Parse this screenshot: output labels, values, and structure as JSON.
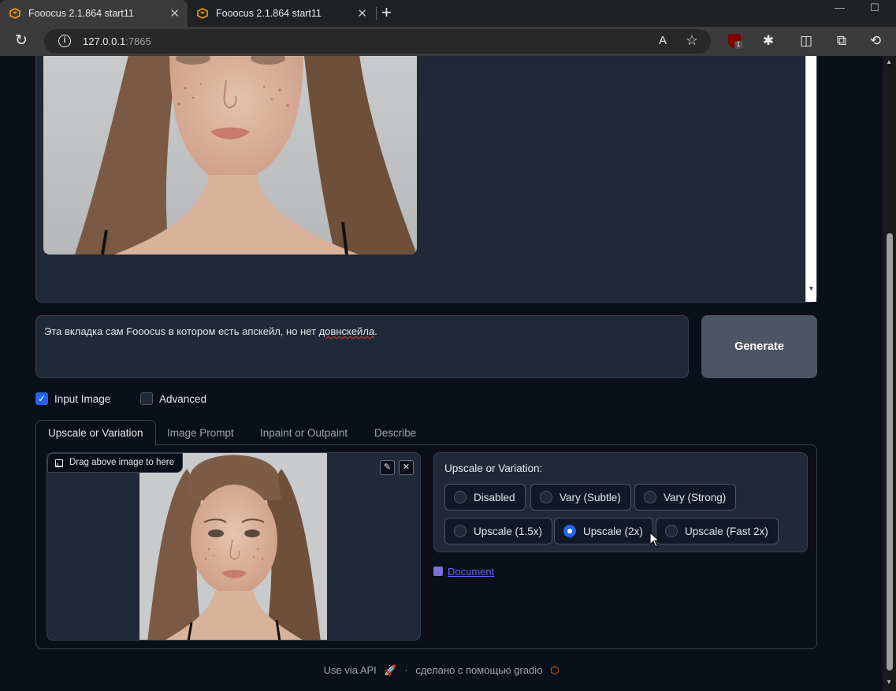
{
  "browser": {
    "tabs": [
      {
        "title": "Fooocus 2.1.864 start11",
        "active": true
      },
      {
        "title": "Fooocus 2.1.864 start11",
        "active": false
      }
    ],
    "new_tab": "+",
    "url_host": "127.0.0.1",
    "url_port": ":7865",
    "extension_badge": "1"
  },
  "prompt": {
    "text_before": "Эта вкладка сам Fooocus в котором есть апскейл, но нет ",
    "misspelled": "довнскейла",
    "text_after": "."
  },
  "generate_label": "Generate",
  "options": {
    "input_image": {
      "label": "Input Image",
      "checked": true
    },
    "advanced": {
      "label": "Advanced",
      "checked": false
    }
  },
  "tabs": [
    "Upscale or Variation",
    "Image Prompt",
    "Inpaint or Outpaint",
    "Describe"
  ],
  "selected_tab": "Upscale or Variation",
  "input_image": {
    "label": "Drag above image to here"
  },
  "upscale": {
    "header": "Upscale or Variation:",
    "options": [
      "Disabled",
      "Vary (Subtle)",
      "Vary (Strong)",
      "Upscale (1.5x)",
      "Upscale (2x)",
      "Upscale (Fast 2x)"
    ],
    "selected": "Upscale (2x)"
  },
  "doc_link": "Document",
  "footer": {
    "api": "Use via API",
    "separator": "·",
    "made_with": "сделано с помощью gradio"
  },
  "colors": {
    "accent": "#2563eb",
    "panel": "#1f2937",
    "background": "#0b0f19",
    "link": "#6366f1"
  }
}
